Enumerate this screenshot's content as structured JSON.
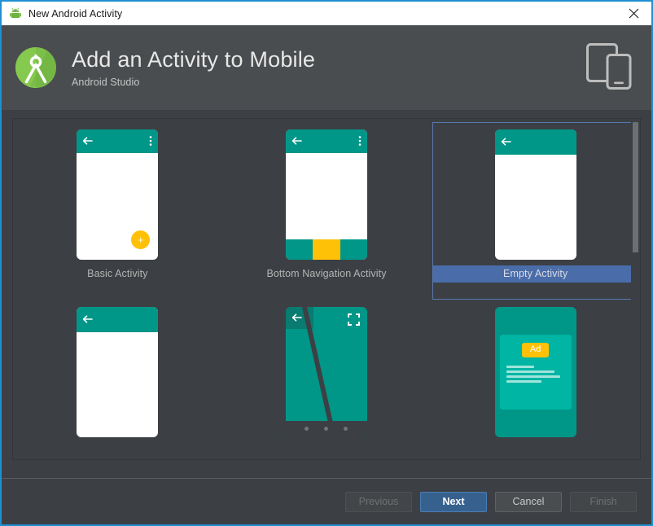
{
  "window": {
    "title": "New Android Activity",
    "title_icon": "android-robot-icon",
    "close_label": "✕"
  },
  "header": {
    "title": "Add an Activity to Mobile",
    "subtitle": "Android Studio",
    "logo_icon": "android-studio-logo",
    "device_icon": "tablet-and-phone-icon"
  },
  "templates": [
    {
      "label": "Basic Activity",
      "selected": false
    },
    {
      "label": "Bottom Navigation Activity",
      "selected": false
    },
    {
      "label": "Empty Activity",
      "selected": true
    },
    {
      "label": "",
      "selected": false
    },
    {
      "label": "",
      "selected": false
    },
    {
      "label": "",
      "selected": false
    }
  ],
  "ad_card": {
    "badge": "Ad"
  },
  "buttons": {
    "previous": "Previous",
    "next": "Next",
    "cancel": "Cancel",
    "finish": "Finish"
  },
  "colors": {
    "accent_blue": "#1e90d2",
    "selection_blue": "#4a6daa",
    "teal": "#009688",
    "teal_light": "#00b5a3",
    "amber": "#ffc107",
    "window_bg": "#3c4044",
    "header_bg": "#4a4d4f"
  }
}
